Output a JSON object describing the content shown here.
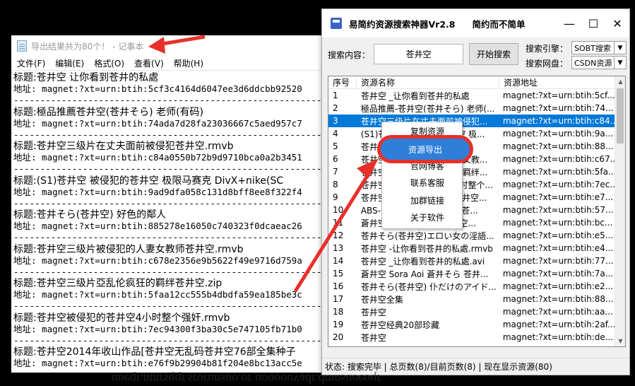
{
  "notepad": {
    "title": "导出结果共为80个！ - 记事本",
    "menu": [
      "文件(F)",
      "编辑(E)",
      "格式(O)",
      "查看(V)",
      "帮助(H)"
    ],
    "records": [
      {
        "title": "标题:苍井空 让你看到苍井的私處",
        "addr": "地址: magnet:?xt=urn:btih:5cf3c4164d6047ee3d6ddcbb92520"
      },
      {
        "title": "标题:極品推薦苍井空(苍井そら) 老师(有码)",
        "addr": "地址: magnet:?xt=urn:btih:74ada7d28fa23036667c5aed957c7"
      },
      {
        "title": "标题:苍井空三级片在丈夫面前被侵犯苍井空.rmvb",
        "addr": "地址: magnet:?xt=urn:btih:c84a0550b72b9d9710bca0a2b3451"
      },
      {
        "title": "标题:(S1)苍井空  被侵犯的苍井空 极限马赛克 DivX+nike(SC",
        "addr": "地址: magnet:?xt=urn:btih:9ad9dfa058c131d8bff8ee8f322f4"
      },
      {
        "title": "标题:苍井そら(苍井空) 好色的鄰人",
        "addr": "地址: magnet:?xt=urn:btih:885278e16050c740323f0dcaeac26"
      },
      {
        "title": "标题:苍井空三级片被侵犯的人妻女教师苍井空.rmvb",
        "addr": "地址: magnet:?xt=urn:btih:c678e2356e9b5622f49e9716d759a"
      },
      {
        "title": "标题:苍井空三级片亞乱伦疯狂的羁绊苍井空.zip",
        "addr": "地址: magnet:?xt=urn:btih:5faa12cc555b4dbdfa59ea185be3c"
      },
      {
        "title": "标题:苍井空被侵犯的苍井空4小时整个强奸.rmvb",
        "addr": "地址: magnet:?xt=urn:btih:7ec94300f3ba30c5e747105fb71b0"
      },
      {
        "title": "标题:苍井空2014年收山作品[苍井空无乱码苍井空76部全集种子",
        "addr": "地址: magnet:?xt=urn:btih:e76f9b29904b81f204e8bc13acc5e"
      }
    ],
    "separator": "-----------------------------------------------------------"
  },
  "tool": {
    "title": "易简约资源搜索神器Vr2.8",
    "slogan": "简约而不简单",
    "search_label": "搜索内容：",
    "search_value": "苍井空",
    "search_button": "开始搜索",
    "engine_label": "搜索引擎：",
    "engine_value": "SOBT搜索",
    "disk_label": "搜索网盘：",
    "disk_value": "CSDN资源",
    "columns": [
      "序号",
      "资源名称",
      "资源地址"
    ],
    "rows": [
      {
        "no": "1",
        "name": "苍井空 _让你看到苍井的私處",
        "addr": "magnet:?xt=urn:btih:5cf..."
      },
      {
        "no": "2",
        "name": "極品推薦-苍井空(苍井そら) 老师(...",
        "addr": "magnet:?xt=urn:btih:74..."
      },
      {
        "no": "3",
        "name": "苍井空三级片在丈夫面前被侵犯...",
        "addr": "magnet:?xt=urn:btih:c84..."
      },
      {
        "no": "4",
        "name": "(S1)苍井空  被侵犯的苍井空 极...",
        "addr": "magnet:?xt=urn:btih:9a..."
      },
      {
        "no": "5",
        "name": "苍井そら(苍井空) 好色的鄰人",
        "addr": "magnet:?xt=urn:btih:88..."
      },
      {
        "no": "6",
        "name": "苍井空三级片被侵犯的人妻女教...",
        "addr": "magnet:?xt=urn:btih:c67..."
      },
      {
        "no": "7",
        "name": "苍井空三级片亞乱伦疯狂的羁绊...",
        "addr": "magnet:?xt=urn:btih:5fa..."
      },
      {
        "no": "8",
        "name": "苍井空被侵犯的苍井空4小时整个...",
        "addr": "magnet:?xt=urn:btih:7ec..."
      },
      {
        "no": "9",
        "name": "苍井空2014年收山作品[苍井空...",
        "addr": "magnet:?xt=urn:btih:e7..."
      },
      {
        "no": "10",
        "name": "ABS-007 苍井空 中出しW苍...",
        "addr": "magnet:?xt=urn:btih:57..."
      },
      {
        "no": "11",
        "name": "蒼井空 苍井空 中出し苍井空...",
        "addr": "magnet:?xt=urn:btih:bc..."
      },
      {
        "no": "12",
        "name": "苍井そら(苍井空)エロい女の淫語...",
        "addr": "magnet:?xt=urn:btih:e5..."
      },
      {
        "no": "13",
        "name": "苍井空 -让你看到苍井的私處.rmvb",
        "addr": "magnet:?xt=urn:btih:e4..."
      },
      {
        "no": "14",
        "name": "苍井空 _让你看到苍井的私處.avi",
        "addr": "magnet:?xt=urn:btih:77..."
      },
      {
        "no": "15",
        "name": "蒼井空 Sora Aoi 蒼井そら 苍井...",
        "addr": "magnet:?xt=urn:btih:7a..."
      },
      {
        "no": "16",
        "name": "苍井そら(苍井空) 仆だけのアイド...",
        "addr": "magnet:?xt=urn:btih:e2..."
      },
      {
        "no": "17",
        "name": "苍井空全集",
        "addr": "magnet:?xt=urn:btih:88..."
      },
      {
        "no": "18",
        "name": "苍井空",
        "addr": "magnet:?xt=urn:btih:aa..."
      },
      {
        "no": "19",
        "name": "苍井空经典20部珍藏",
        "addr": "magnet:?xt=urn:btih:2af..."
      },
      {
        "no": "20",
        "name": "苍井空",
        "addr": "magnet:?xt=urn:btih:de..."
      }
    ],
    "selected_row": "3",
    "status": "状态: 搜索完毕 | 总页数(8)/目前页数(8) | 现在显示资源(80)"
  },
  "context_menu": {
    "items": [
      "复制资源",
      "资源导出",
      "官网博客",
      "联系客服",
      "加群链接",
      "关于软件"
    ],
    "highlighted": "资源导出"
  },
  "colors": {
    "accent": "#0078d7",
    "annotation": "#e8302a"
  },
  "footer_mirror": "uoeqr.ntnrsqqr.srorunsuo.or uoooouvadr.dmnsuoeoqr"
}
